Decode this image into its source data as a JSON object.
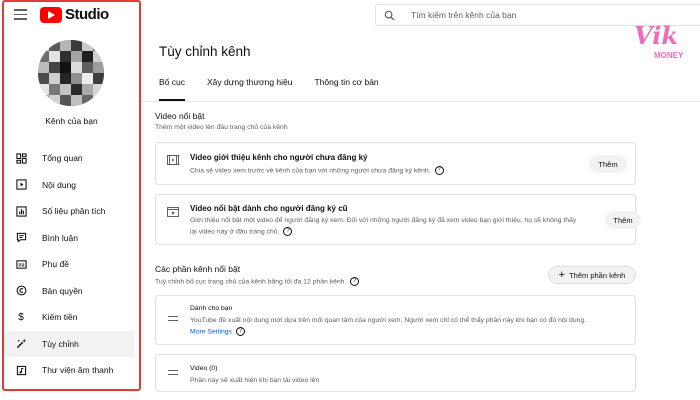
{
  "topbar": {
    "brand": "Studio",
    "search_placeholder": "Tìm kiếm trên kênh của bạn"
  },
  "sidebar": {
    "channel_label": "Kênh của bạn",
    "items": [
      {
        "label": "Tổng quan",
        "icon": "dashboard-icon"
      },
      {
        "label": "Nội dung",
        "icon": "content-icon"
      },
      {
        "label": "Số liệu phân tích",
        "icon": "analytics-icon"
      },
      {
        "label": "Bình luận",
        "icon": "comments-icon"
      },
      {
        "label": "Phụ đề",
        "icon": "subtitles-icon"
      },
      {
        "label": "Bản quyền",
        "icon": "copyright-icon"
      },
      {
        "label": "Kiếm tiền",
        "icon": "monetization-icon"
      },
      {
        "label": "Tùy chỉnh",
        "icon": "customization-icon",
        "active": true
      },
      {
        "label": "Thư viện âm thanh",
        "icon": "audio-library-icon"
      }
    ]
  },
  "main": {
    "title": "Tùy chỉnh kênh",
    "tabs": [
      "Bố cục",
      "Xây dựng thương hiệu",
      "Thông tin cơ bản"
    ],
    "featured_video": {
      "title": "Video nổi bật",
      "subtitle": "Thêm một video lên đầu trang chủ của kênh",
      "cards": [
        {
          "title": "Video giới thiệu kênh cho người chưa đăng ký",
          "desc": "Chia sẻ video xem trước về kênh của bạn với những người chưa đăng ký kênh.",
          "button": "Thêm"
        },
        {
          "title": "Video nổi bật dành cho người đăng ký cũ",
          "desc_line1": "Giới thiệu nổi bật một video để người đăng ký xem. Đối với những người đăng ký đã xem video bạn giới thiệu, họ sẽ không thấy",
          "desc_line2": "lại video này ở đầu trang chủ.",
          "button": "Thêm"
        }
      ]
    },
    "featured_sections": {
      "title": "Các phần kênh nổi bật",
      "subtitle": "Tuỳ chỉnh bố cục trang chủ của kênh bằng tối đa 12 phần kênh.",
      "add_button": "Thêm phần kênh",
      "sections": [
        {
          "title": "Dành cho bạn",
          "desc": "YouTube đề xuất nội dung mới dựa trên mối quan tâm của người xem. Người xem chỉ có thể thấy phần này khi bạn có đủ nội dung.",
          "link": "More Settings"
        },
        {
          "title": "Video (0)",
          "desc": "Phần này sẽ xuất hiện khi bạn tải video lên"
        }
      ]
    }
  },
  "watermark": {
    "text_main": "Vik",
    "text_sub": "MONEY",
    "color": "#f06cb8"
  },
  "colors": {
    "brand_red": "#ff0000",
    "highlight_border": "#e53935",
    "link": "#065fd4"
  }
}
